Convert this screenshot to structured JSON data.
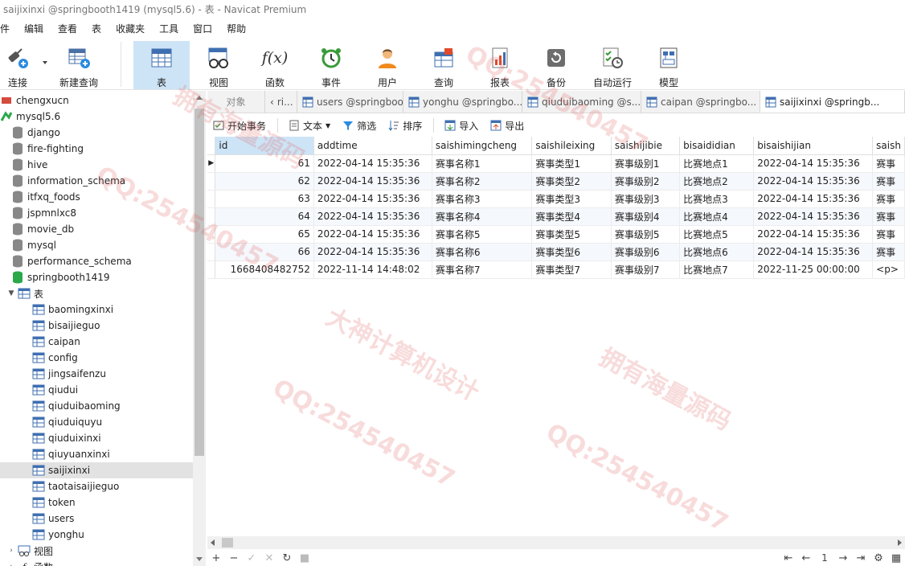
{
  "window": {
    "title": "saijixinxi @springbooth1419 (mysql5.6) - 表 - Navicat Premium"
  },
  "menu": [
    "件",
    "编辑",
    "查看",
    "表",
    "收藏夹",
    "工具",
    "窗口",
    "帮助"
  ],
  "toolbar": {
    "connect": "连接",
    "new_query": "新建查询",
    "table": "表",
    "view": "视图",
    "function": "函数",
    "event": "事件",
    "user": "用户",
    "query": "查询",
    "report": "报表",
    "backup": "备份",
    "automation": "自动运行",
    "model": "模型",
    "function_glyph": "f(x)"
  },
  "tree": {
    "items": [
      "chengxucn",
      "mysql5.6",
      "django",
      "fire-fighting",
      "hive",
      "information_schema",
      "itfxq_foods",
      "jspmnlxc8",
      "movie_db",
      "mysql",
      "performance_schema",
      "springbooth1419",
      "表"
    ],
    "tables": [
      "baomingxinxi",
      "bisaijieguo",
      "caipan",
      "config",
      "jingsaifenzu",
      "qiudui",
      "qiuduibaoming",
      "qiuduiquyu",
      "qiuduixinxi",
      "qiuyuanxinxi",
      "saijixinxi",
      "taotaisaijieguo",
      "token",
      "users",
      "yonghu"
    ],
    "views": "视图",
    "functions": "函数"
  },
  "tabs": {
    "objects": "对象",
    "items": [
      "ri...",
      "users @springboot...",
      "yonghu @springbo...",
      "qiuduibaoming @s...",
      "caipan @springbo...",
      "saijixinxi @springb..."
    ]
  },
  "subtoolbar": {
    "begin_tx": "开始事务",
    "text": "文本",
    "filter": "筛选",
    "sort": "排序",
    "import": "导入",
    "export": "导出"
  },
  "grid": {
    "columns": [
      "id",
      "addtime",
      "saishimingcheng",
      "saishileixing",
      "saishijibie",
      "bisaididian",
      "bisaishijian",
      "saish"
    ],
    "rows": [
      [
        "61",
        "2022-04-14 15:35:36",
        "赛事名称1",
        "赛事类型1",
        "赛事级别1",
        "比赛地点1",
        "2022-04-14 15:35:36",
        "赛事"
      ],
      [
        "62",
        "2022-04-14 15:35:36",
        "赛事名称2",
        "赛事类型2",
        "赛事级别2",
        "比赛地点2",
        "2022-04-14 15:35:36",
        "赛事"
      ],
      [
        "63",
        "2022-04-14 15:35:36",
        "赛事名称3",
        "赛事类型3",
        "赛事级别3",
        "比赛地点3",
        "2022-04-14 15:35:36",
        "赛事"
      ],
      [
        "64",
        "2022-04-14 15:35:36",
        "赛事名称4",
        "赛事类型4",
        "赛事级别4",
        "比赛地点4",
        "2022-04-14 15:35:36",
        "赛事"
      ],
      [
        "65",
        "2022-04-14 15:35:36",
        "赛事名称5",
        "赛事类型5",
        "赛事级别5",
        "比赛地点5",
        "2022-04-14 15:35:36",
        "赛事"
      ],
      [
        "66",
        "2022-04-14 15:35:36",
        "赛事名称6",
        "赛事类型6",
        "赛事级别6",
        "比赛地点6",
        "2022-04-14 15:35:36",
        "赛事"
      ],
      [
        "1668408482752",
        "2022-11-14 14:48:02",
        "赛事名称7",
        "赛事类型7",
        "赛事级别7",
        "比赛地点7",
        "2022-11-25 00:00:00",
        "<p>"
      ]
    ]
  },
  "status": {
    "page": "1"
  },
  "watermarks": [
    "QQ:254540457",
    "大神计算机设计",
    "拥有海量源码"
  ],
  "colors": {
    "selected_bg": "#cde4f7",
    "watermark": "#e15a5a"
  }
}
